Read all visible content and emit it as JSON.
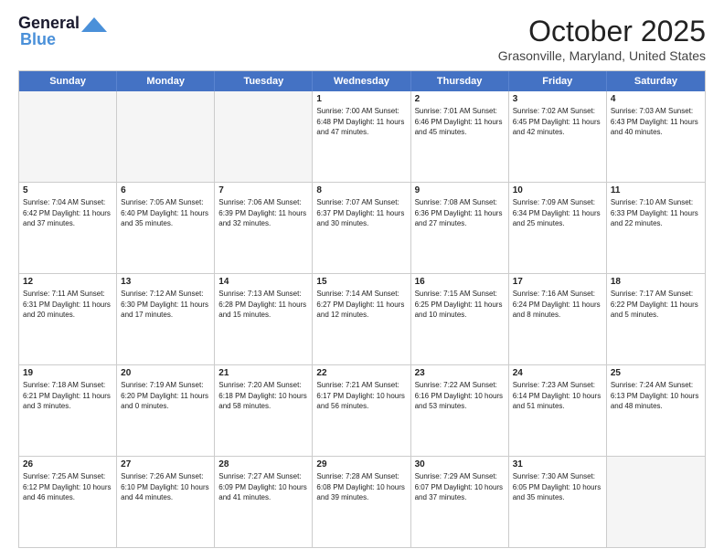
{
  "header": {
    "logo_general": "General",
    "logo_blue": "Blue",
    "month": "October 2025",
    "location": "Grasonville, Maryland, United States"
  },
  "days_of_week": [
    "Sunday",
    "Monday",
    "Tuesday",
    "Wednesday",
    "Thursday",
    "Friday",
    "Saturday"
  ],
  "weeks": [
    [
      {
        "num": "",
        "info": ""
      },
      {
        "num": "",
        "info": ""
      },
      {
        "num": "",
        "info": ""
      },
      {
        "num": "1",
        "info": "Sunrise: 7:00 AM\nSunset: 6:48 PM\nDaylight: 11 hours\nand 47 minutes."
      },
      {
        "num": "2",
        "info": "Sunrise: 7:01 AM\nSunset: 6:46 PM\nDaylight: 11 hours\nand 45 minutes."
      },
      {
        "num": "3",
        "info": "Sunrise: 7:02 AM\nSunset: 6:45 PM\nDaylight: 11 hours\nand 42 minutes."
      },
      {
        "num": "4",
        "info": "Sunrise: 7:03 AM\nSunset: 6:43 PM\nDaylight: 11 hours\nand 40 minutes."
      }
    ],
    [
      {
        "num": "5",
        "info": "Sunrise: 7:04 AM\nSunset: 6:42 PM\nDaylight: 11 hours\nand 37 minutes."
      },
      {
        "num": "6",
        "info": "Sunrise: 7:05 AM\nSunset: 6:40 PM\nDaylight: 11 hours\nand 35 minutes."
      },
      {
        "num": "7",
        "info": "Sunrise: 7:06 AM\nSunset: 6:39 PM\nDaylight: 11 hours\nand 32 minutes."
      },
      {
        "num": "8",
        "info": "Sunrise: 7:07 AM\nSunset: 6:37 PM\nDaylight: 11 hours\nand 30 minutes."
      },
      {
        "num": "9",
        "info": "Sunrise: 7:08 AM\nSunset: 6:36 PM\nDaylight: 11 hours\nand 27 minutes."
      },
      {
        "num": "10",
        "info": "Sunrise: 7:09 AM\nSunset: 6:34 PM\nDaylight: 11 hours\nand 25 minutes."
      },
      {
        "num": "11",
        "info": "Sunrise: 7:10 AM\nSunset: 6:33 PM\nDaylight: 11 hours\nand 22 minutes."
      }
    ],
    [
      {
        "num": "12",
        "info": "Sunrise: 7:11 AM\nSunset: 6:31 PM\nDaylight: 11 hours\nand 20 minutes."
      },
      {
        "num": "13",
        "info": "Sunrise: 7:12 AM\nSunset: 6:30 PM\nDaylight: 11 hours\nand 17 minutes."
      },
      {
        "num": "14",
        "info": "Sunrise: 7:13 AM\nSunset: 6:28 PM\nDaylight: 11 hours\nand 15 minutes."
      },
      {
        "num": "15",
        "info": "Sunrise: 7:14 AM\nSunset: 6:27 PM\nDaylight: 11 hours\nand 12 minutes."
      },
      {
        "num": "16",
        "info": "Sunrise: 7:15 AM\nSunset: 6:25 PM\nDaylight: 11 hours\nand 10 minutes."
      },
      {
        "num": "17",
        "info": "Sunrise: 7:16 AM\nSunset: 6:24 PM\nDaylight: 11 hours\nand 8 minutes."
      },
      {
        "num": "18",
        "info": "Sunrise: 7:17 AM\nSunset: 6:22 PM\nDaylight: 11 hours\nand 5 minutes."
      }
    ],
    [
      {
        "num": "19",
        "info": "Sunrise: 7:18 AM\nSunset: 6:21 PM\nDaylight: 11 hours\nand 3 minutes."
      },
      {
        "num": "20",
        "info": "Sunrise: 7:19 AM\nSunset: 6:20 PM\nDaylight: 11 hours\nand 0 minutes."
      },
      {
        "num": "21",
        "info": "Sunrise: 7:20 AM\nSunset: 6:18 PM\nDaylight: 10 hours\nand 58 minutes."
      },
      {
        "num": "22",
        "info": "Sunrise: 7:21 AM\nSunset: 6:17 PM\nDaylight: 10 hours\nand 56 minutes."
      },
      {
        "num": "23",
        "info": "Sunrise: 7:22 AM\nSunset: 6:16 PM\nDaylight: 10 hours\nand 53 minutes."
      },
      {
        "num": "24",
        "info": "Sunrise: 7:23 AM\nSunset: 6:14 PM\nDaylight: 10 hours\nand 51 minutes."
      },
      {
        "num": "25",
        "info": "Sunrise: 7:24 AM\nSunset: 6:13 PM\nDaylight: 10 hours\nand 48 minutes."
      }
    ],
    [
      {
        "num": "26",
        "info": "Sunrise: 7:25 AM\nSunset: 6:12 PM\nDaylight: 10 hours\nand 46 minutes."
      },
      {
        "num": "27",
        "info": "Sunrise: 7:26 AM\nSunset: 6:10 PM\nDaylight: 10 hours\nand 44 minutes."
      },
      {
        "num": "28",
        "info": "Sunrise: 7:27 AM\nSunset: 6:09 PM\nDaylight: 10 hours\nand 41 minutes."
      },
      {
        "num": "29",
        "info": "Sunrise: 7:28 AM\nSunset: 6:08 PM\nDaylight: 10 hours\nand 39 minutes."
      },
      {
        "num": "30",
        "info": "Sunrise: 7:29 AM\nSunset: 6:07 PM\nDaylight: 10 hours\nand 37 minutes."
      },
      {
        "num": "31",
        "info": "Sunrise: 7:30 AM\nSunset: 6:05 PM\nDaylight: 10 hours\nand 35 minutes."
      },
      {
        "num": "",
        "info": ""
      }
    ]
  ]
}
